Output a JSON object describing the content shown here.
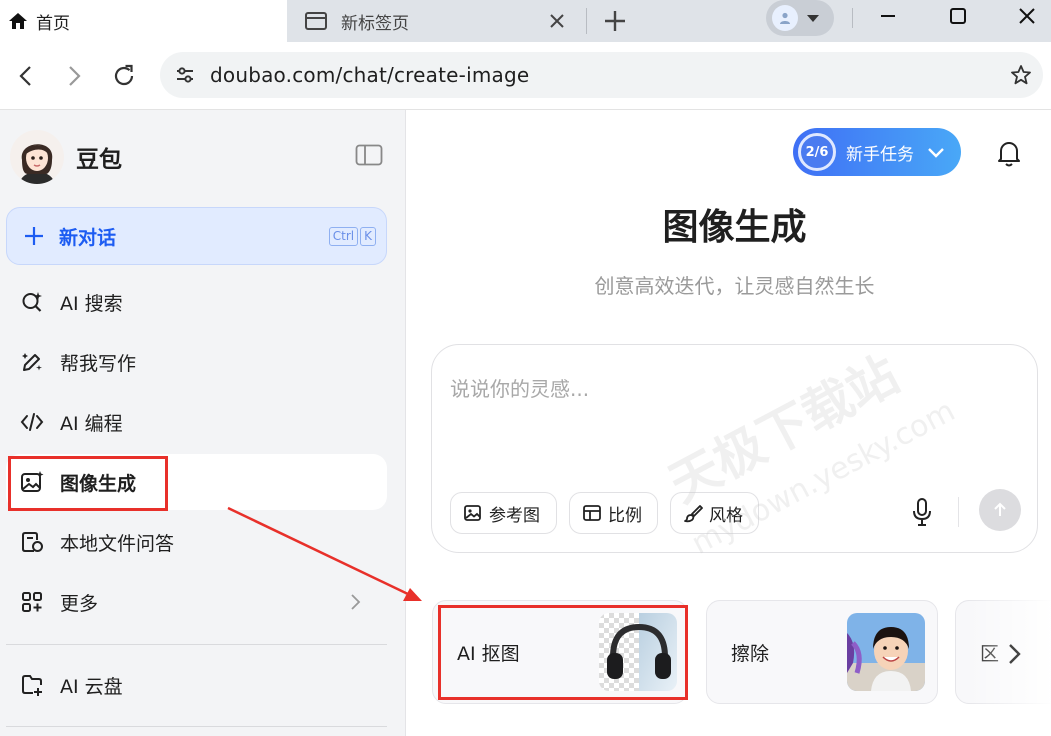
{
  "browser": {
    "active_tab": {
      "title": "首页"
    },
    "inactive_tab": {
      "title": "新标签页"
    },
    "url": "doubao.com/chat/create-image"
  },
  "sidebar": {
    "brand_name": "豆包",
    "new_chat": {
      "label": "新对话",
      "shortcut": [
        "Ctrl",
        "K"
      ]
    },
    "items": [
      {
        "label": "AI 搜索",
        "icon": "ai-search-icon"
      },
      {
        "label": "帮我写作",
        "icon": "pen-sparkle-icon"
      },
      {
        "label": "AI 编程",
        "icon": "code-icon"
      },
      {
        "label": "图像生成",
        "icon": "image-gen-icon",
        "active": true
      },
      {
        "label": "本地文件问答",
        "icon": "file-chat-icon"
      },
      {
        "label": "更多",
        "icon": "grid-plus-icon"
      },
      {
        "label": "AI 云盘",
        "icon": "cloud-folder-icon"
      }
    ]
  },
  "main": {
    "task_pill": {
      "badge": "2/6",
      "label": "新手任务"
    },
    "title": "图像生成",
    "subtitle": "创意高效迭代，让灵感自然生长",
    "composer": {
      "placeholder": "说说你的灵感...",
      "chips": [
        {
          "label": "参考图",
          "icon": "image-ref-icon"
        },
        {
          "label": "比例",
          "icon": "ratio-icon"
        },
        {
          "label": "风格",
          "icon": "brush-icon"
        }
      ]
    },
    "tool_cards": [
      {
        "label": "AI 抠图"
      },
      {
        "label": "擦除"
      },
      {
        "label": "区"
      }
    ]
  },
  "watermark": {
    "text": "天极下载站",
    "sub": "mydown.yesky.com"
  },
  "colors": {
    "accent": "#1d5cf2",
    "highlight": "#e8302a",
    "sidebar_bg": "#f3f4f6"
  }
}
